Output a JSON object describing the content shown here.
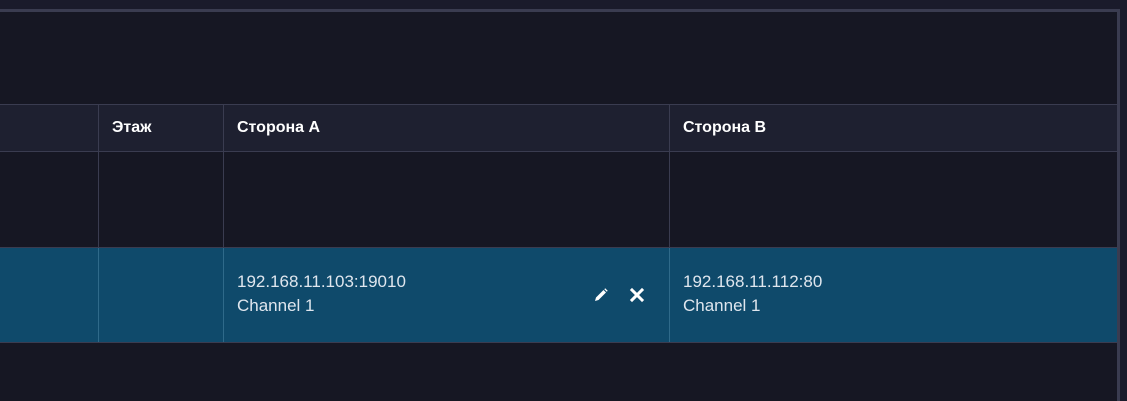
{
  "table": {
    "columns": {
      "floor": "Этаж",
      "side_a": "Сторона А",
      "side_b": "Сторона В"
    },
    "rows": [
      {
        "floor": "",
        "side_a": {
          "address": "",
          "channel": ""
        },
        "side_b": {
          "address": "",
          "channel": ""
        }
      },
      {
        "selected": true,
        "floor": "",
        "side_a": {
          "address": "192.168.11.103:19010",
          "channel": "Channel 1"
        },
        "side_b": {
          "address": "192.168.11.112:80",
          "channel": "Channel 1"
        }
      }
    ]
  },
  "icons": {
    "edit": "pencil-icon",
    "delete": "close-icon"
  },
  "colors": {
    "background": "#161723",
    "header": "#1e2030",
    "selected_row": "#0f4a6b",
    "border": "#3a3c50",
    "text": "#ffffff"
  }
}
